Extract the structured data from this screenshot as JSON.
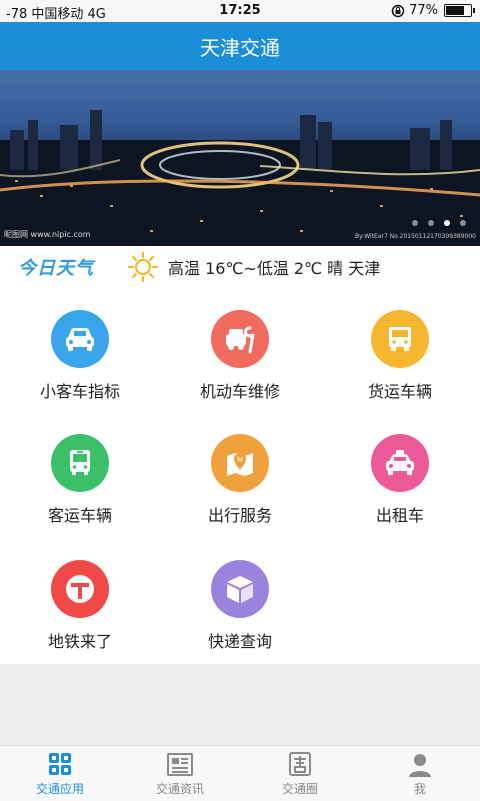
{
  "status_bar": {
    "carrier": "-78 中国移动   4G",
    "time": "17:25",
    "battery": "77%",
    "battery_level": 0.77
  },
  "header": {
    "title": "天津交通"
  },
  "banner": {
    "credit_left": "昵图网 www.nipic.com",
    "credit_right": "By:WitEar7 No.20150112170309389000",
    "pages": 4,
    "active_page": 2
  },
  "weather": {
    "logo": "今日天气",
    "summary": "高温 16℃~低温 2℃   晴   天津",
    "icon": "sun-icon"
  },
  "services": [
    {
      "label": "小客车指标",
      "icon": "car-icon",
      "color": "#3aa6ea"
    },
    {
      "label": "机动车维修",
      "icon": "wrench-car-icon",
      "color": "#f06b5e"
    },
    {
      "label": "货运车辆",
      "icon": "truck-icon",
      "color": "#f7b62f"
    },
    {
      "label": "客运车辆",
      "icon": "bus-icon",
      "color": "#3bbf69"
    },
    {
      "label": "出行服务",
      "icon": "map-pin-icon",
      "color": "#f0a13c"
    },
    {
      "label": "出租车",
      "icon": "taxi-icon",
      "color": "#ec5a97"
    },
    {
      "label": "地铁来了",
      "icon": "metro-icon",
      "color": "#ef4a48"
    },
    {
      "label": "快递查询",
      "icon": "package-icon",
      "color": "#9a83dd"
    }
  ],
  "tabs": [
    {
      "label": "交通应用",
      "icon": "grid-apps-icon",
      "active": true
    },
    {
      "label": "交通资讯",
      "icon": "newspaper-icon",
      "active": false
    },
    {
      "label": "交通圈",
      "icon": "circle-badge-icon",
      "active": false
    },
    {
      "label": "我",
      "icon": "person-icon",
      "active": false
    }
  ],
  "colors": {
    "accent": "#1a8fd8",
    "tab_inactive": "#888888"
  }
}
